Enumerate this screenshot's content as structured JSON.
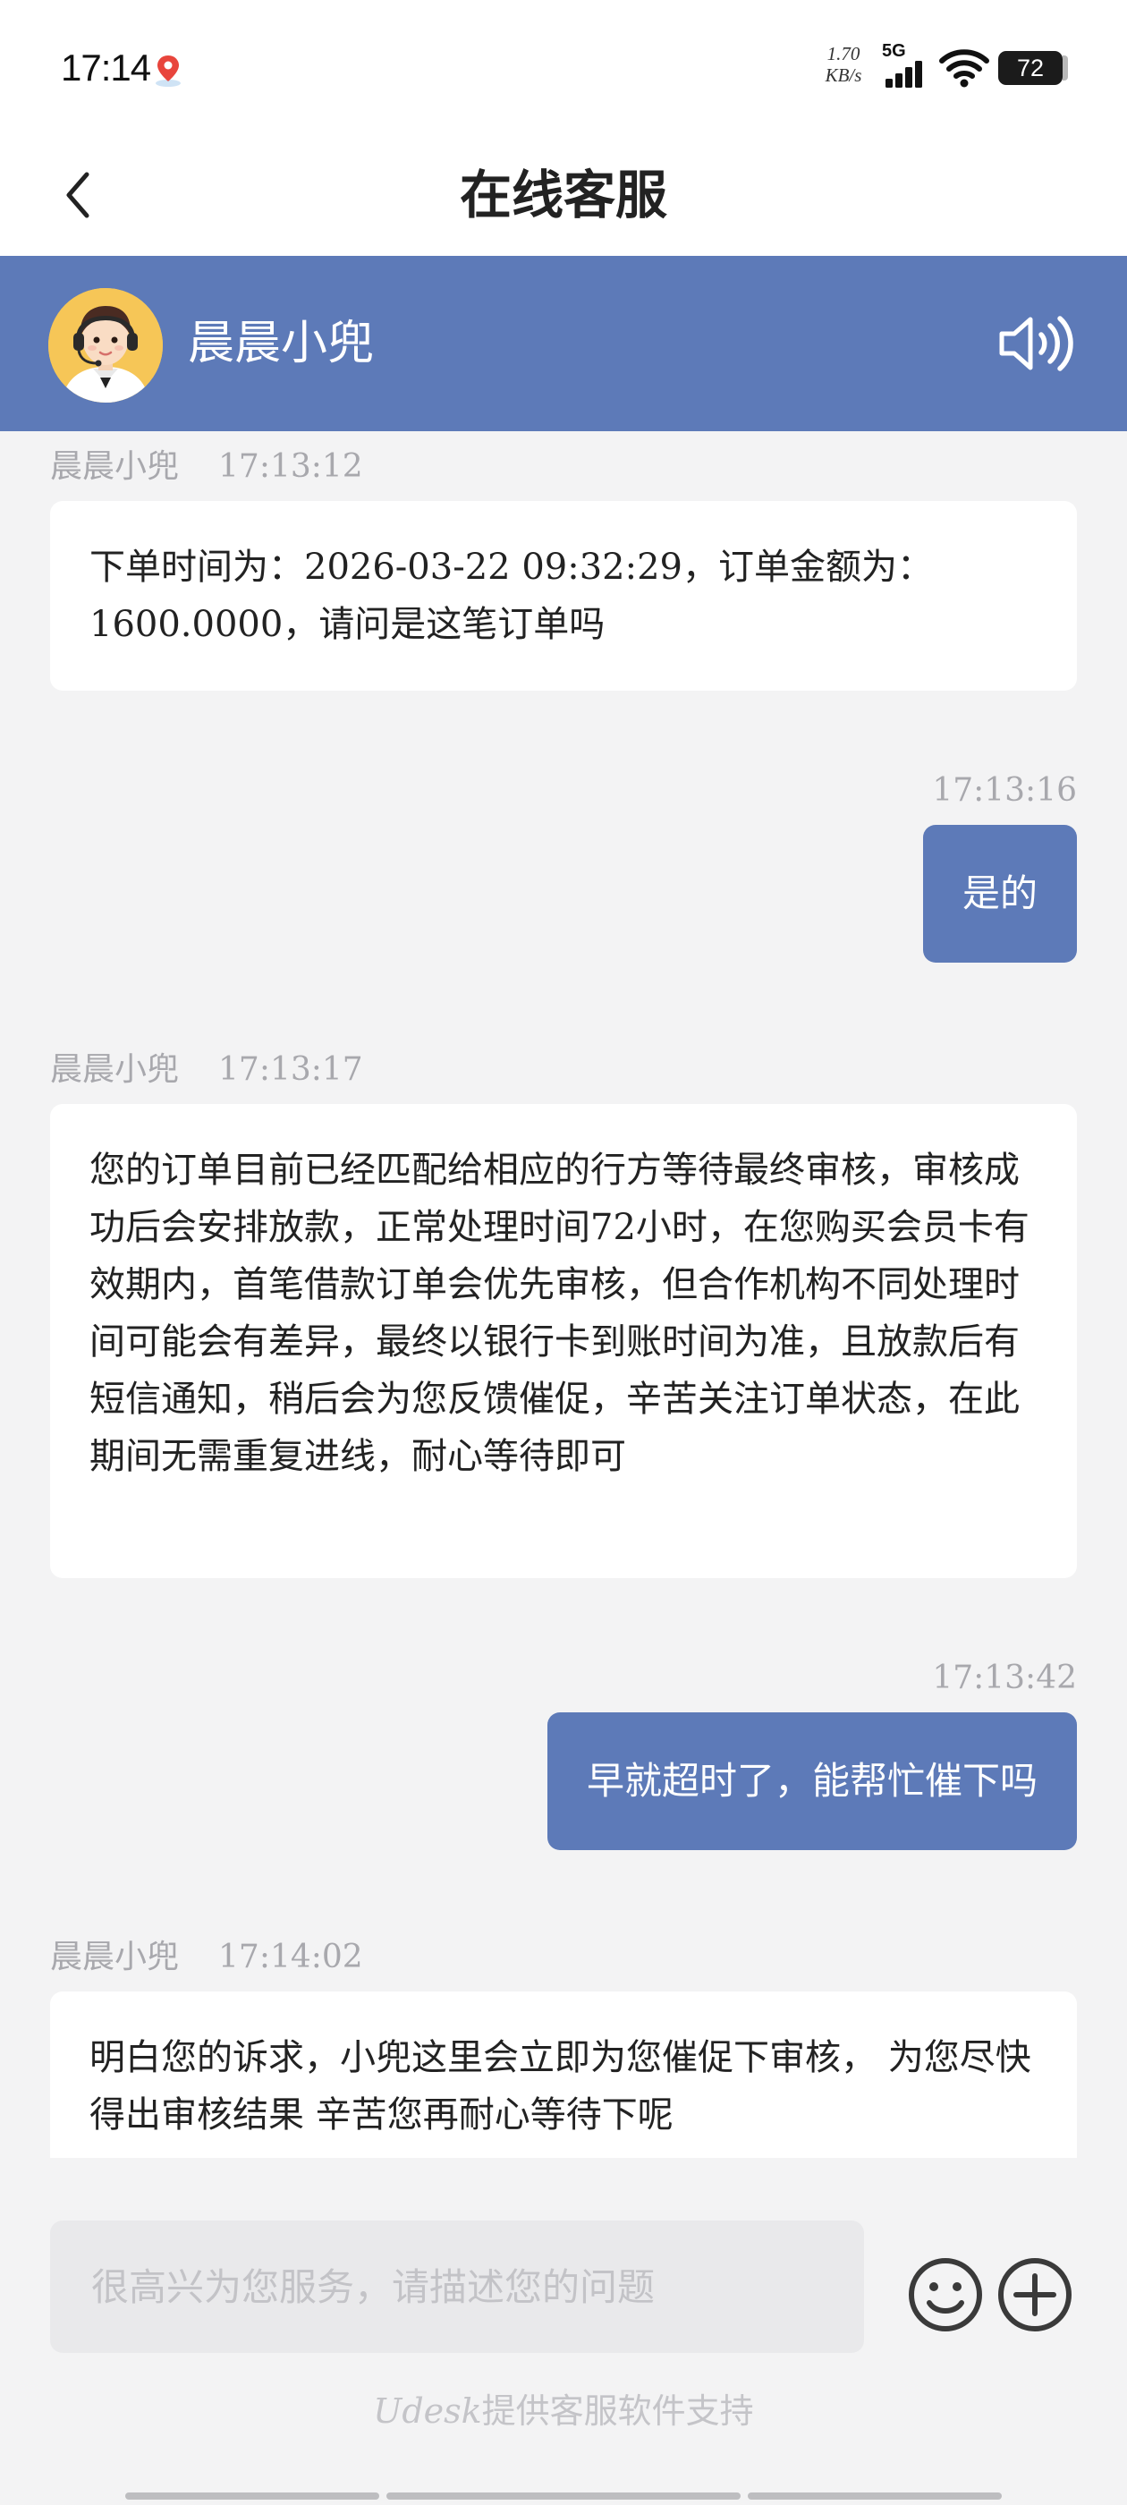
{
  "status_bar": {
    "time": "17:14",
    "net_speed_value": "1.70",
    "net_speed_unit": "KB/s",
    "network_type": "5G",
    "battery_level": "72",
    "location_icon": "location-pin-icon",
    "signal_icon": "signal-bars-icon",
    "wifi_icon": "wifi-icon"
  },
  "titlebar": {
    "title": "在线客服",
    "back_icon": "chevron-left-icon"
  },
  "agent": {
    "name": "晨晨小兜",
    "avatar_icon": "customer-service-avatar-icon",
    "speaker_icon": "speaker-icon"
  },
  "messages": [
    {
      "direction": "in",
      "sender": "晨晨小兜",
      "time": "17:13:12",
      "text": "下单时间为：2026-03-22 09:32:29，订单金额为：1600.0000，请问是这笔订单吗"
    },
    {
      "direction": "out",
      "time": "17:13:16",
      "text": "是的"
    },
    {
      "direction": "in",
      "sender": "晨晨小兜",
      "time": "17:13:17",
      "text": "您的订单目前已经匹配给相应的行方等待最终审核，审核成功后会安排放款，正常处理时间72小时，在您购买会员卡有效期内，首笔借款订单会优先审核，但合作机构不同处理时间可能会有差异，最终以银行卡到账时间为准，且放款后有短信通知，稍后会为您反馈催促，辛苦关注订单状态，在此期间无需重复进线，耐心等待即可"
    },
    {
      "direction": "out",
      "time": "17:13:42",
      "text": "早就超时了，能帮忙催下吗"
    },
    {
      "direction": "in",
      "sender": "晨晨小兜",
      "time": "17:14:02",
      "text": "明白您的诉求，小兜这里会立即为您催促下审核， 为您尽快得出审核结果 辛苦您再耐心等待下呢"
    }
  ],
  "input": {
    "placeholder": "很高兴为您服务，请描述您的问题",
    "emoji_icon": "emoji-smile-icon",
    "plus_icon": "plus-circle-icon"
  },
  "footer": {
    "brand": "Udesk",
    "text": "提供客服软件支持"
  },
  "colors": {
    "accent": "#5d7ab8",
    "background": "#f3f3f4",
    "avatar_bg": "#f6c657"
  }
}
